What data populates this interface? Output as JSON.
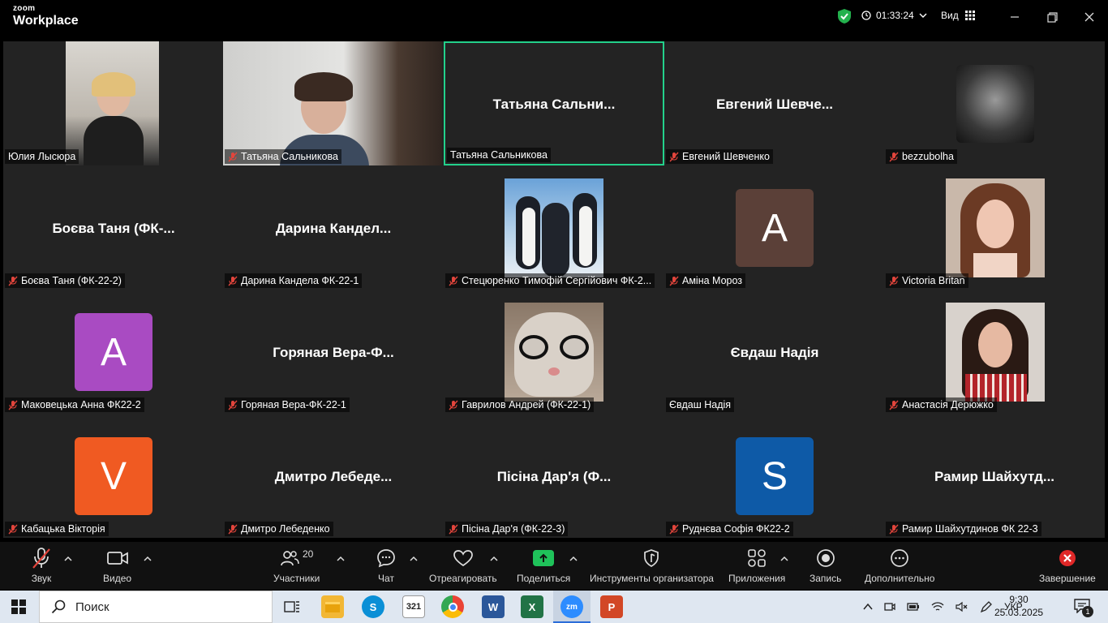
{
  "app": {
    "brand_small": "zoom",
    "brand_big": "Workplace"
  },
  "titlebar": {
    "timer": "01:33:24",
    "view_label": "Вид"
  },
  "tiles": [
    {
      "label": "Юлия Лысюра",
      "muted": false
    },
    {
      "label": "Татьяна Сальникова",
      "muted": true
    },
    {
      "display": "Татьяна  Сальни...",
      "label": "Татьяна Сальникова",
      "muted": false
    },
    {
      "display": "Евгений  Шевче...",
      "label": "Евгений Шевченко",
      "muted": true
    },
    {
      "label": "bezzubolha",
      "muted": true
    },
    {
      "display": "Боєва Таня (ФК-...",
      "label": "Боєва Таня (ФК-22-2)",
      "muted": true
    },
    {
      "display": "Дарина  Кандел...",
      "label": "Дарина Кандела ФК-22-1",
      "muted": true
    },
    {
      "label": "Стецюренко Тимофій Сергійович ФК-2...",
      "muted": true
    },
    {
      "avatar": "A",
      "label": "Аміна Мороз",
      "muted": true
    },
    {
      "label": "Victoria Britan",
      "muted": true
    },
    {
      "avatar": "A",
      "label": "Маковецька Анна ФК22-2",
      "muted": true
    },
    {
      "display": "Горяная  Вера-Ф...",
      "label": "Горяная Вера-ФК-22-1",
      "muted": true
    },
    {
      "label": "Гаврилов Андрей (ФК-22-1)",
      "muted": true
    },
    {
      "display": "Євдаш Надія",
      "label": "Євдаш Надія",
      "muted": false
    },
    {
      "label": "Анастасія Дерюжко",
      "muted": true
    },
    {
      "avatar": "V",
      "label": "Кабацька Вікторія",
      "muted": true
    },
    {
      "display": "Дмитро  Лебеде...",
      "label": "Дмитро Лебеденко",
      "muted": true
    },
    {
      "display": "Пісіна Дар'я (Ф...",
      "label": "Пісіна Дар'я (ФК-22-3)",
      "muted": true
    },
    {
      "avatar": "S",
      "label": "Руднєва Софія ФК22-2",
      "muted": true
    },
    {
      "display": "Рамир  Шайхутд...",
      "label": "Рамир Шайхутдинов ФК 22-3",
      "muted": true
    }
  ],
  "toolbar": {
    "audio": "Звук",
    "video": "Видео",
    "participants": "Участники",
    "participants_count": "20",
    "chat": "Чат",
    "react": "Отреагировать",
    "share": "Поделиться",
    "host_tools": "Инструменты организатора",
    "apps": "Приложения",
    "record": "Запись",
    "more": "Дополнительно",
    "end": "Завершение"
  },
  "taskbar": {
    "search": "Поиск",
    "lang": "УКР",
    "time": "9:30",
    "date": "25.03.2025",
    "notifications": "1"
  },
  "colors": {
    "active_speaker": "#23d18b",
    "avatar_brown": "#5b4038",
    "avatar_purple": "#a94bc2",
    "avatar_orange": "#f05a22",
    "avatar_blue": "#0e5aa7",
    "share_green": "#1fc25a",
    "end_red": "#e02828"
  }
}
